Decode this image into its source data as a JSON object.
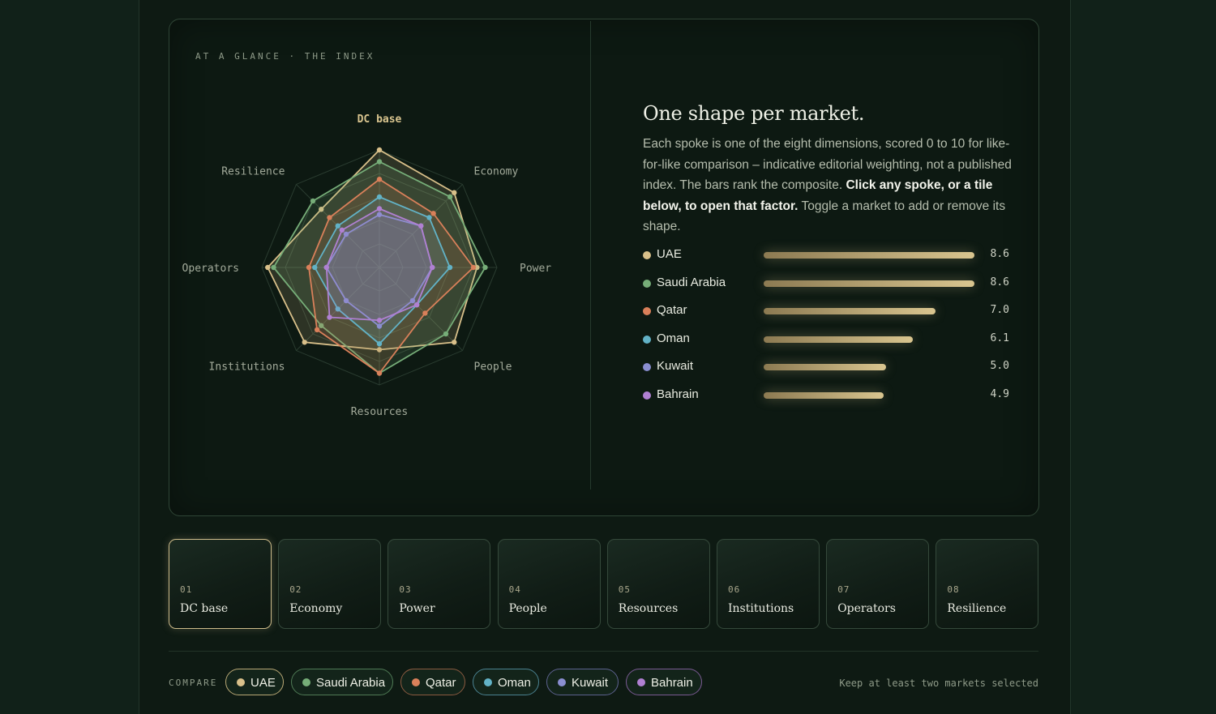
{
  "eyebrow": "AT A GLANCE · THE INDEX",
  "heading": "One shape per market.",
  "description": {
    "part1": "Each spoke is one of the eight dimensions, scored 0 to 10 for like-for-like comparison – indicative editorial weighting, not a published index. The bars rank the composite.",
    "bold": "Click any spoke, or a tile below, to open that factor.",
    "part2": "Toggle a market to add or remove its shape."
  },
  "ranking": [
    {
      "name": "UAE",
      "value": 8.6,
      "display": "8.6",
      "color": "#d9c08a"
    },
    {
      "name": "Saudi Arabia",
      "value": 8.6,
      "display": "8.6",
      "color": "#76ad78"
    },
    {
      "name": "Qatar",
      "value": 7.0,
      "display": "7.0",
      "color": "#d9805a"
    },
    {
      "name": "Oman",
      "value": 6.1,
      "display": "6.1",
      "color": "#62b2c6"
    },
    {
      "name": "Kuwait",
      "value": 5.0,
      "display": "5.0",
      "color": "#8a8ed0"
    },
    {
      "name": "Bahrain",
      "value": 4.9,
      "display": "4.9",
      "color": "#b080d2"
    }
  ],
  "tiles": [
    {
      "num": "01",
      "name": "DC base",
      "active": true
    },
    {
      "num": "02",
      "name": "Economy"
    },
    {
      "num": "03",
      "name": "Power"
    },
    {
      "num": "04",
      "name": "People"
    },
    {
      "num": "05",
      "name": "Resources"
    },
    {
      "num": "06",
      "name": "Institutions"
    },
    {
      "num": "07",
      "name": "Operators"
    },
    {
      "num": "08",
      "name": "Resilience"
    }
  ],
  "compare": {
    "label": "COMPARE",
    "hint": "Keep at least two markets selected",
    "chips": [
      {
        "name": "UAE",
        "color": "#d9c08a",
        "border": "#b9a875"
      },
      {
        "name": "Saudi Arabia",
        "color": "#76ad78",
        "border": "#4f7a55"
      },
      {
        "name": "Qatar",
        "color": "#d9805a",
        "border": "#8a5a40"
      },
      {
        "name": "Oman",
        "color": "#62b2c6",
        "border": "#4a8190"
      },
      {
        "name": "Kuwait",
        "color": "#8a8ed0",
        "border": "#5c618e"
      },
      {
        "name": "Bahrain",
        "color": "#b080d2",
        "border": "#7a5a93"
      }
    ]
  },
  "chart_data": {
    "type": "radar",
    "axes": [
      "DC base",
      "Economy",
      "Power",
      "People",
      "Resources",
      "Institutions",
      "Operators",
      "Resilience"
    ],
    "active_axis": "DC base",
    "range": [
      0,
      10
    ],
    "rings": 5,
    "series": [
      {
        "name": "UAE",
        "color": "#d9c08a",
        "values": [
          10,
          9.0,
          8.3,
          9.0,
          7.0,
          9.0,
          9.5,
          7.0
        ]
      },
      {
        "name": "Saudi Arabia",
        "color": "#76ad78",
        "values": [
          9.0,
          8.5,
          9.0,
          8.0,
          9.0,
          7.0,
          9.0,
          8.0
        ]
      },
      {
        "name": "Qatar",
        "color": "#d9805a",
        "values": [
          7.5,
          6.5,
          8.0,
          5.5,
          9.0,
          7.5,
          6.0,
          6.0
        ]
      },
      {
        "name": "Oman",
        "color": "#62b2c6",
        "values": [
          6.0,
          6.0,
          6.0,
          4.5,
          6.5,
          5.0,
          5.5,
          5.0
        ]
      },
      {
        "name": "Kuwait",
        "color": "#8a8ed0",
        "values": [
          4.5,
          5.0,
          4.5,
          4.0,
          5.0,
          4.0,
          4.5,
          4.0
        ]
      },
      {
        "name": "Bahrain",
        "color": "#b080d2",
        "values": [
          5.0,
          5.0,
          4.5,
          4.5,
          4.5,
          6.0,
          4.5,
          4.5
        ]
      }
    ]
  }
}
